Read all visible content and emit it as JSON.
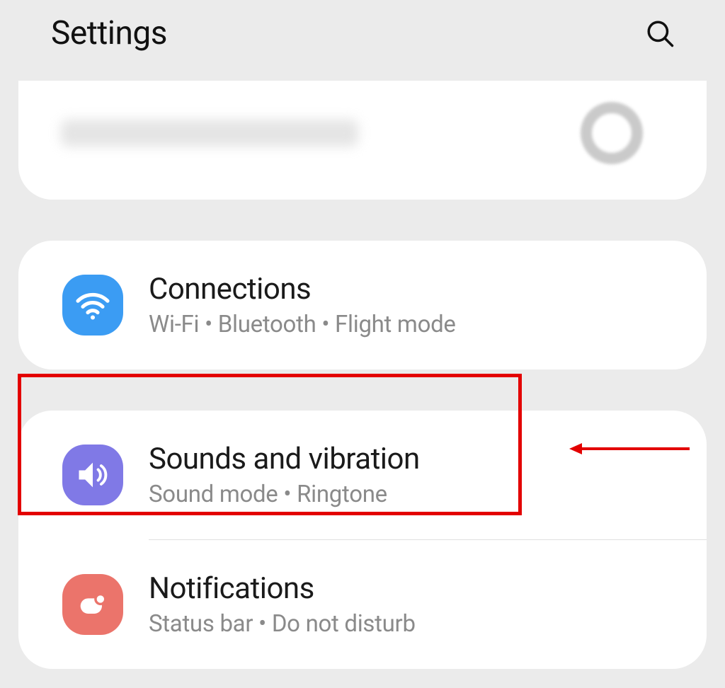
{
  "header": {
    "title": "Settings"
  },
  "items": {
    "connections": {
      "title": "Connections",
      "subtitle": "Wi-Fi  •  Bluetooth  •  Flight mode"
    },
    "sounds": {
      "title": "Sounds and vibration",
      "subtitle": "Sound mode  •  Ringtone"
    },
    "notifications": {
      "title": "Notifications",
      "subtitle": "Status bar  •  Do not disturb"
    }
  }
}
